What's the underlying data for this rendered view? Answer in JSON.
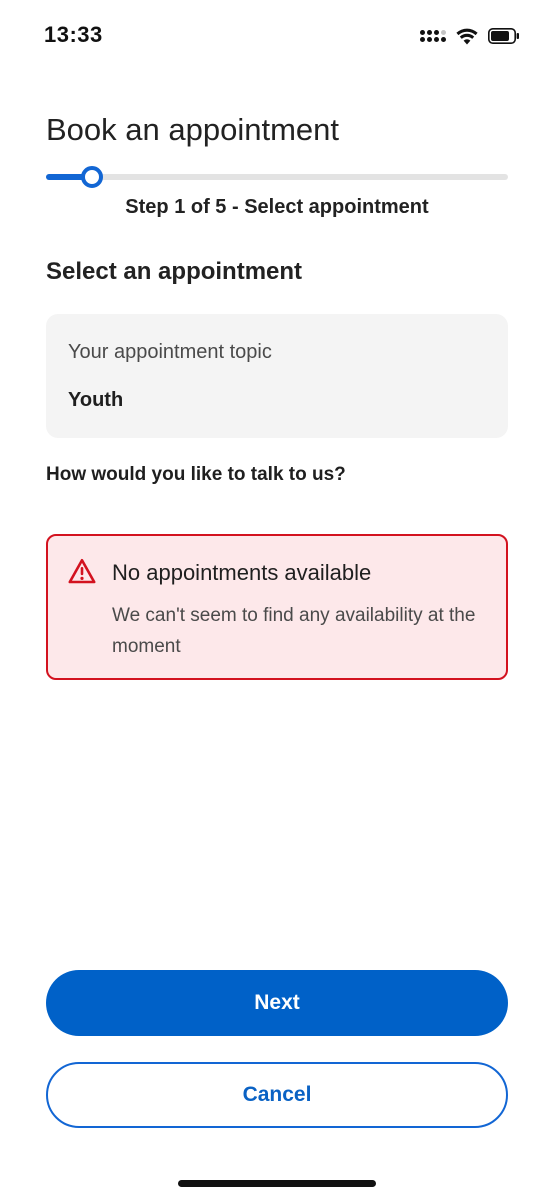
{
  "status_bar": {
    "time": "13:33"
  },
  "header": {
    "title": "Book an appointment"
  },
  "progress": {
    "current_step": 1,
    "total_steps": 5,
    "fraction": 0.1,
    "label": "Step 1 of 5 - Select appointment",
    "color": "#1266d4"
  },
  "section": {
    "title": "Select an appointment"
  },
  "topic": {
    "label": "Your appointment topic",
    "value": "Youth"
  },
  "question": "How would you like to talk to us?",
  "alert": {
    "icon": "warning-triangle-icon",
    "title": "No appointments available",
    "body": "We can't seem to find any availability at the moment",
    "color": "#d3121f"
  },
  "actions": {
    "next_label": "Next",
    "cancel_label": "Cancel",
    "primary_color": "#0061c8"
  }
}
